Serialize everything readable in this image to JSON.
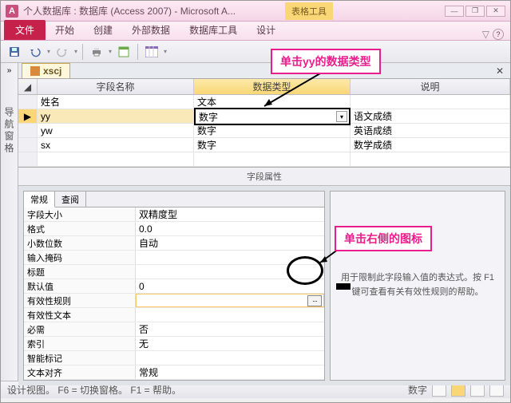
{
  "title": "个人数据库 : 数据库 (Access 2007) - Microsoft A...",
  "app_letter": "A",
  "context_tab": "表格工具",
  "ribbon": {
    "file": "文件",
    "tabs": [
      "开始",
      "创建",
      "外部数据",
      "数据库工具",
      "设计"
    ]
  },
  "nav_label": "导航窗格",
  "object_tab": "xscj",
  "grid": {
    "headers": [
      "字段名称",
      "数据类型",
      "说明"
    ],
    "rows": [
      {
        "name": "姓名",
        "type": "文本",
        "desc": ""
      },
      {
        "name": "yy",
        "type": "数字",
        "desc": "语文成绩",
        "sel": true
      },
      {
        "name": "yw",
        "type": "数字",
        "desc": "英语成绩"
      },
      {
        "name": "sx",
        "type": "数字",
        "desc": "数学成绩"
      }
    ]
  },
  "field_props_label": "字段属性",
  "prop_tabs": [
    "常规",
    "查阅"
  ],
  "props": [
    {
      "label": "字段大小",
      "val": "双精度型"
    },
    {
      "label": "格式",
      "val": "0.0"
    },
    {
      "label": "小数位数",
      "val": "自动"
    },
    {
      "label": "输入掩码",
      "val": ""
    },
    {
      "label": "标题",
      "val": ""
    },
    {
      "label": "默认值",
      "val": "0"
    },
    {
      "label": "有效性规则",
      "val": "",
      "active": true,
      "builder": true
    },
    {
      "label": "有效性文本",
      "val": ""
    },
    {
      "label": "必需",
      "val": "否"
    },
    {
      "label": "索引",
      "val": "无"
    },
    {
      "label": "智能标记",
      "val": ""
    },
    {
      "label": "文本对齐",
      "val": "常规"
    }
  ],
  "help_text": "用于限制此字段输入值的表达式。按 F1 键可查看有关有效性规则的帮助。",
  "statusbar": {
    "left": "设计视图。   F6 = 切换窗格。   F1 = 帮助。",
    "mode": "数字"
  },
  "callouts": {
    "c1": "单击yy的数据类型",
    "c2": "单击右侧的图标"
  }
}
